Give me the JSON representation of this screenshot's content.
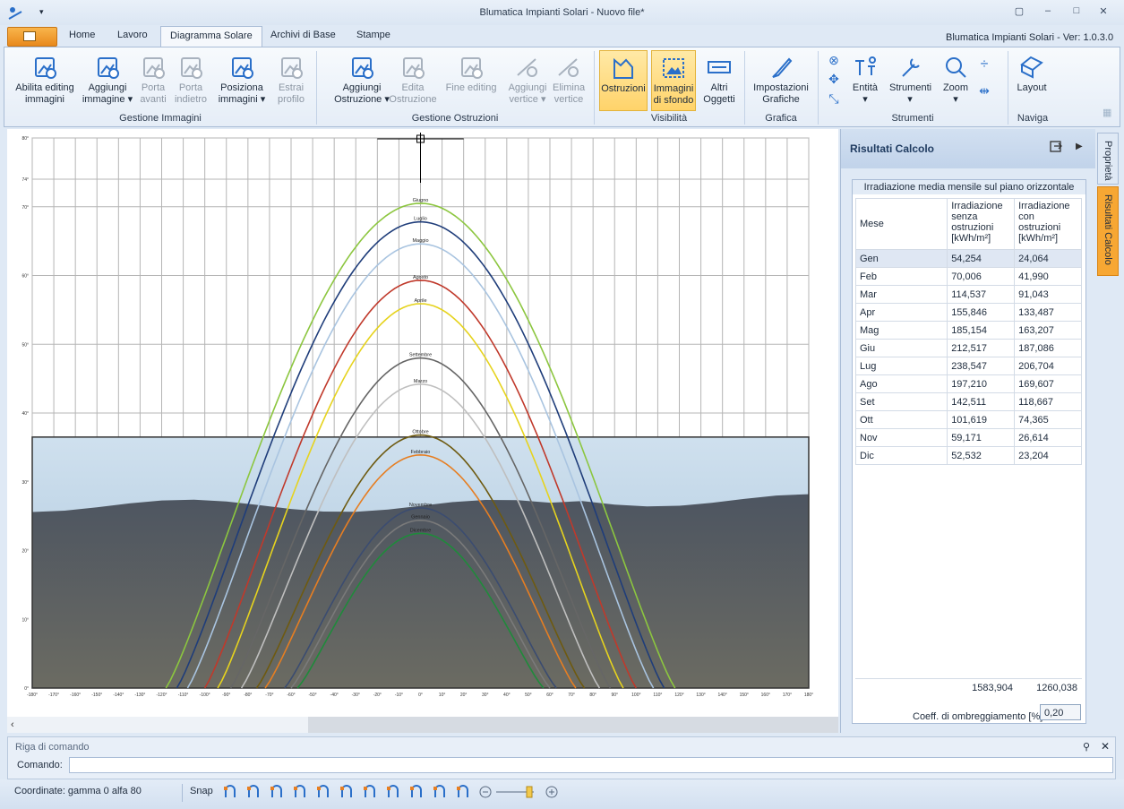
{
  "window": {
    "title": "Blumatica Impianti Solari - Nuovo file*",
    "version": "Blumatica Impianti Solari - Ver: 1.0.3.0"
  },
  "tabs": [
    "Home",
    "Lavoro",
    "Diagramma Solare",
    "Archivi di Base",
    "Stampe"
  ],
  "ribbon": {
    "groups": [
      {
        "label": "Gestione Immagini",
        "buttons": [
          {
            "label": "Abilita editing\nimmagini",
            "state": "normal"
          },
          {
            "label": "Aggiungi\nimmagine ▾",
            "state": "normal"
          },
          {
            "label": "Porta\navanti",
            "state": "disabled"
          },
          {
            "label": "Porta\nindietro",
            "state": "disabled"
          },
          {
            "label": "Posiziona\nimmagini ▾",
            "state": "normal"
          },
          {
            "label": "Estrai\nprofilo",
            "state": "disabled"
          }
        ]
      },
      {
        "label": "Gestione Ostruzioni",
        "buttons": [
          {
            "label": "Aggiungi\nOstruzione ▾",
            "state": "normal"
          },
          {
            "label": "Edita\nOstruzione",
            "state": "disabled"
          },
          {
            "label": "Fine editing",
            "state": "disabled"
          },
          {
            "label": "Aggiungi\nvertice ▾",
            "state": "disabled"
          },
          {
            "label": "Elimina\nvertice",
            "state": "disabled"
          }
        ]
      },
      {
        "label": "Visibilità",
        "buttons": [
          {
            "label": "Ostruzioni",
            "state": "active"
          },
          {
            "label": "Immagini\ndi sfondo",
            "state": "active"
          },
          {
            "label": "Altri\nOggetti",
            "state": "normal"
          }
        ]
      },
      {
        "label": "Grafica",
        "buttons": [
          {
            "label": "Impostazioni\nGrafiche",
            "state": "normal"
          }
        ]
      },
      {
        "label": "Strumenti",
        "buttons": [
          {
            "label": "Entità\n▾",
            "state": "normal"
          },
          {
            "label": "Strumenti\n▾",
            "state": "normal"
          },
          {
            "label": "Zoom\n▾",
            "state": "normal"
          }
        ]
      },
      {
        "label": "Naviga",
        "buttons": [
          {
            "label": "Layout",
            "state": "normal"
          }
        ]
      }
    ]
  },
  "panel": {
    "title": "Risultati Calcolo",
    "table_caption": "Irradiazione media mensile sul piano orizzontale",
    "columns": [
      "Mese",
      "Irradiazione senza ostruzioni [kWh/m²]",
      "Irradiazione con ostruzioni [kWh/m²]"
    ],
    "rows": [
      [
        "Gen",
        "54,254",
        "24,064"
      ],
      [
        "Feb",
        "70,006",
        "41,990"
      ],
      [
        "Mar",
        "114,537",
        "91,043"
      ],
      [
        "Apr",
        "155,846",
        "133,487"
      ],
      [
        "Mag",
        "185,154",
        "163,207"
      ],
      [
        "Giu",
        "212,517",
        "187,086"
      ],
      [
        "Lug",
        "238,547",
        "206,704"
      ],
      [
        "Ago",
        "197,210",
        "169,607"
      ],
      [
        "Set",
        "142,511",
        "118,667"
      ],
      [
        "Ott",
        "101,619",
        "74,365"
      ],
      [
        "Nov",
        "59,171",
        "26,614"
      ],
      [
        "Dic",
        "52,532",
        "23,204"
      ]
    ],
    "totals": [
      "1583,904",
      "1260,038"
    ],
    "coeff_label": "Coeff. di ombreggiamento [%]",
    "coeff_value": "0,20"
  },
  "side_tabs": [
    "Proprietà",
    "Risultati Calcolo"
  ],
  "command": {
    "title": "Riga di comando",
    "label": "Comando:",
    "value": ""
  },
  "status": {
    "coords": "Coordinate: gamma 0 alfa 80",
    "snap": "Snap"
  },
  "chart_data": {
    "type": "line",
    "x_ticks": [
      "-180°",
      "-170°",
      "-160°",
      "-150°",
      "-140°",
      "-130°",
      "-120°",
      "-110°",
      "-100°",
      "-90°",
      "-80°",
      "-70°",
      "-60°",
      "-50°",
      "-40°",
      "-30°",
      "-20°",
      "-10°",
      "0°",
      "10°",
      "20°",
      "30°",
      "40°",
      "50°",
      "60°",
      "70°",
      "80°",
      "90°",
      "100°",
      "110°",
      "120°",
      "130°",
      "140°",
      "150°",
      "160°",
      "170°",
      "180°"
    ],
    "y_ticks": [
      "0°",
      "10°",
      "20°",
      "30°",
      "40°",
      "50°",
      "60°",
      "70°",
      "74°",
      "80°"
    ],
    "xlim": [
      -180,
      180
    ],
    "series": [
      {
        "name": "Giugno",
        "peak": 70.5,
        "half": 118,
        "color": "#8cc63f"
      },
      {
        "name": "Luglio",
        "peak": 67.8,
        "half": 113,
        "color": "#1f3d7a"
      },
      {
        "name": "Maggio",
        "peak": 64.6,
        "half": 108,
        "color": "#a9c4e0"
      },
      {
        "name": "Agosto",
        "peak": 59.3,
        "half": 100,
        "color": "#c0392b"
      },
      {
        "name": "Aprile",
        "peak": 55.9,
        "half": 94,
        "color": "#e6d31e"
      },
      {
        "name": "Settembre",
        "peak": 48.0,
        "half": 88,
        "color": "#666666"
      },
      {
        "name": "Marzo",
        "peak": 44.2,
        "half": 83,
        "color": "#bfbfbf"
      },
      {
        "name": "Ottobre",
        "peak": 36.8,
        "half": 76,
        "color": "#6e5a10"
      },
      {
        "name": "Febbraio",
        "peak": 33.9,
        "half": 72,
        "color": "#e67e22"
      },
      {
        "name": "Novembre",
        "peak": 26.2,
        "half": 63,
        "color": "#3b4c70"
      },
      {
        "name": "Gennaio",
        "peak": 24.4,
        "half": 60,
        "color": "#7a7a7a"
      },
      {
        "name": "Dicembre",
        "peak": 22.5,
        "half": 57,
        "color": "#1f8a3b"
      }
    ]
  }
}
